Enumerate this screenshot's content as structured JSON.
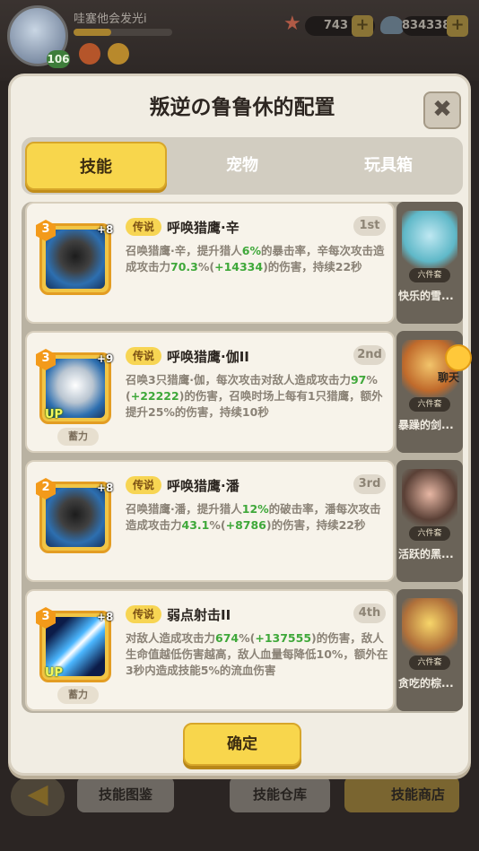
{
  "hud": {
    "player_name": "哇塞他会发光i",
    "level": "106",
    "xp_progress": 0.38,
    "currency_starfish": "743",
    "currency_shell": "834338"
  },
  "dialog": {
    "title": "叛逆の鲁鲁休的配置",
    "close_label": "✖",
    "tabs": [
      {
        "label": "技能",
        "active": true
      },
      {
        "label": "宠物",
        "active": false
      },
      {
        "label": "玩具箱",
        "active": false
      }
    ],
    "skills": [
      {
        "rank": "3",
        "plus": "+8",
        "up": "",
        "charge": "",
        "tag": "传说",
        "name": "呼唤猎鹰·辛",
        "order": "1st",
        "desc_parts": [
          "召唤猎鹰·辛，提升猎人",
          "6%",
          "的暴击率，辛每次攻击造成攻击力",
          "70.3",
          "%(",
          "+14334",
          ")的伤害，持续22秒"
        ]
      },
      {
        "rank": "3",
        "plus": "+9",
        "up": "UP",
        "charge": "蓄力",
        "tag": "传说",
        "name": "呼唤猎鹰·伽II",
        "order": "2nd",
        "desc_parts": [
          "召唤3只猎鹰·伽，每次攻击对敌人造成攻击力",
          "97",
          "%(",
          "+22222",
          ")的伤害，召唤时场上每有1只猎鹰，额外提升25%的伤害，持续10秒"
        ]
      },
      {
        "rank": "2",
        "plus": "+8",
        "up": "",
        "charge": "",
        "tag": "传说",
        "name": "呼唤猎鹰·潘",
        "order": "3rd",
        "desc_parts": [
          "召唤猎鹰·潘，提升猎人",
          "12%",
          "的破击率，潘每次攻击造成攻击力",
          "43.1",
          "%(",
          "+8786",
          ")的伤害，持续22秒"
        ]
      },
      {
        "rank": "3",
        "plus": "+8",
        "up": "UP",
        "charge": "蓄力",
        "tag": "传说",
        "name": "弱点射击II",
        "order": "4th",
        "desc_parts": [
          "对敌人造成攻击力",
          "674",
          "%(",
          "+137555",
          ")的伤害，敌人生命值越低伤害越高，敌人血量每降低10%，额外在3秒内造成技能5%的流血伤害"
        ]
      }
    ],
    "pets": [
      {
        "name": "快乐的雪...",
        "set": "六件套"
      },
      {
        "name": "暴躁的剑...",
        "set": "六件套"
      },
      {
        "name": "活跃的黑...",
        "set": "六件套"
      },
      {
        "name": "贪吃的棕...",
        "set": "六件套"
      }
    ],
    "confirm_label": "确定"
  },
  "chat": {
    "label": "聊天"
  },
  "bottom_bar": {
    "back_icon": "arrow-left-icon",
    "tabs": [
      "技能图鉴",
      "技能仓库",
      "技能商店"
    ]
  },
  "colors": {
    "accent_yellow": "#f8d64c",
    "green_value": "#3fa83a",
    "panel_bg": "#f1ede3"
  }
}
